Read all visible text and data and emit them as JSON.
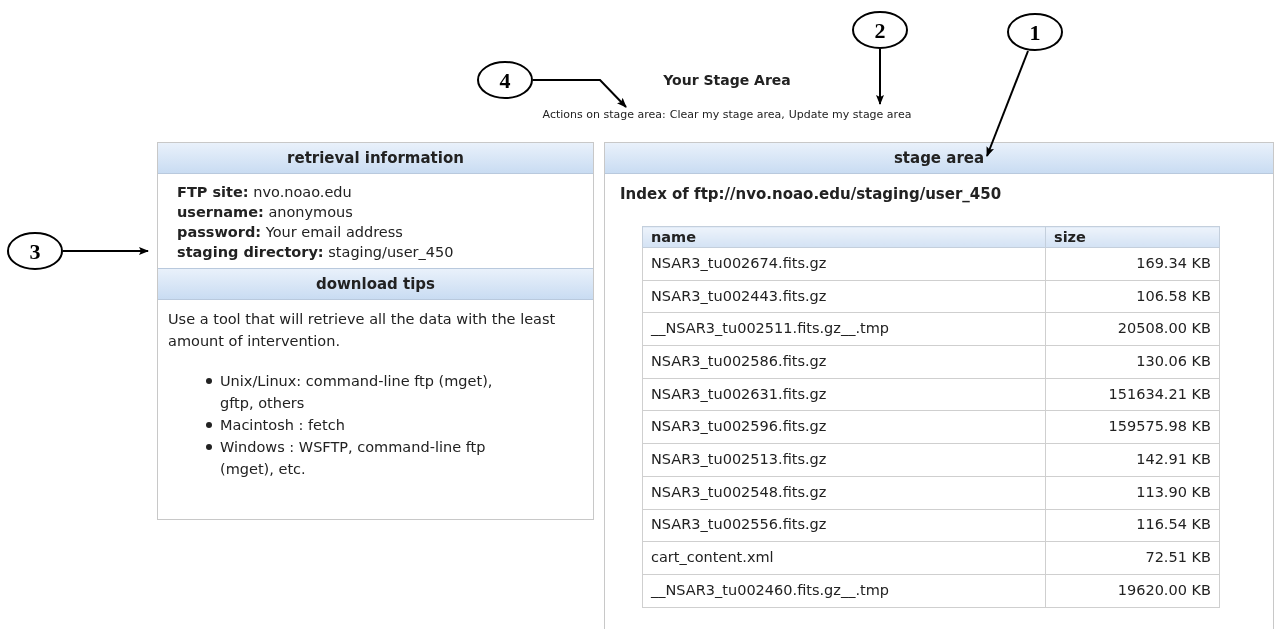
{
  "page": {
    "title": "Your Stage Area",
    "actions_label": "Actions on stage area:",
    "actions": [
      {
        "label": "Clear my stage area"
      },
      {
        "label": "Update my stage area"
      }
    ],
    "separator": ","
  },
  "retrieval_information": {
    "title": "retrieval information",
    "fields": [
      {
        "label": "FTP site:",
        "value": "nvo.noao.edu"
      },
      {
        "label": "username:",
        "value": "anonymous"
      },
      {
        "label": "password:",
        "value": "Your email address"
      },
      {
        "label": "staging directory:",
        "value": "staging/user_450"
      }
    ]
  },
  "download_tips": {
    "title": "download tips",
    "intro": "Use a tool that will retrieve all the data with the least amount of intervention.",
    "items": [
      "Unix/Linux: command-line ftp (mget), gftp, others",
      "Macintosh : fetch",
      "Windows : WSFTP, command-line ftp (mget), etc."
    ]
  },
  "stage_area": {
    "title": "stage area",
    "index_title": "Index of ftp://nvo.noao.edu/staging/user_450",
    "table": {
      "columns": [
        "name",
        "size"
      ],
      "rows": [
        [
          "NSAR3_tu002674.fits.gz",
          "169.34 KB"
        ],
        [
          "NSAR3_tu002443.fits.gz",
          "106.58 KB"
        ],
        [
          "__NSAR3_tu002511.fits.gz__.tmp",
          "20508.00 KB"
        ],
        [
          "NSAR3_tu002586.fits.gz",
          "130.06 KB"
        ],
        [
          "NSAR3_tu002631.fits.gz",
          "151634.21 KB"
        ],
        [
          "NSAR3_tu002596.fits.gz",
          "159575.98 KB"
        ],
        [
          "NSAR3_tu002513.fits.gz",
          "142.91 KB"
        ],
        [
          "NSAR3_tu002548.fits.gz",
          "113.90 KB"
        ],
        [
          "NSAR3_tu002556.fits.gz",
          "116.54 KB"
        ],
        [
          "cart_content.xml",
          "72.51 KB"
        ],
        [
          "__NSAR3_tu002460.fits.gz__.tmp",
          "19620.00 KB"
        ]
      ]
    }
  },
  "callouts": [
    {
      "number": "1"
    },
    {
      "number": "2"
    },
    {
      "number": "3"
    },
    {
      "number": "4"
    }
  ]
}
